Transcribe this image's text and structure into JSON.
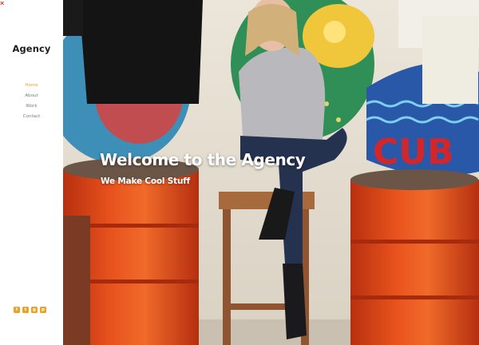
{
  "sidebar": {
    "close_glyph": "×",
    "brand": "Agency",
    "nav": [
      {
        "label": "Home",
        "active": true
      },
      {
        "label": "About",
        "active": false
      },
      {
        "label": "Work",
        "active": false
      },
      {
        "label": "Contact",
        "active": false
      }
    ],
    "socials": [
      {
        "name": "facebook-icon",
        "glyph": "f"
      },
      {
        "name": "twitter-icon",
        "glyph": "t"
      },
      {
        "name": "google-plus-icon",
        "glyph": "g"
      },
      {
        "name": "pinterest-icon",
        "glyph": "p"
      }
    ],
    "accent_color": "#e9a22c",
    "close_color": "#e0342c"
  },
  "hero": {
    "title": "Welcome to the Agency",
    "subtitle": "We Make Cool Stuff",
    "mural_text": "CUB"
  }
}
